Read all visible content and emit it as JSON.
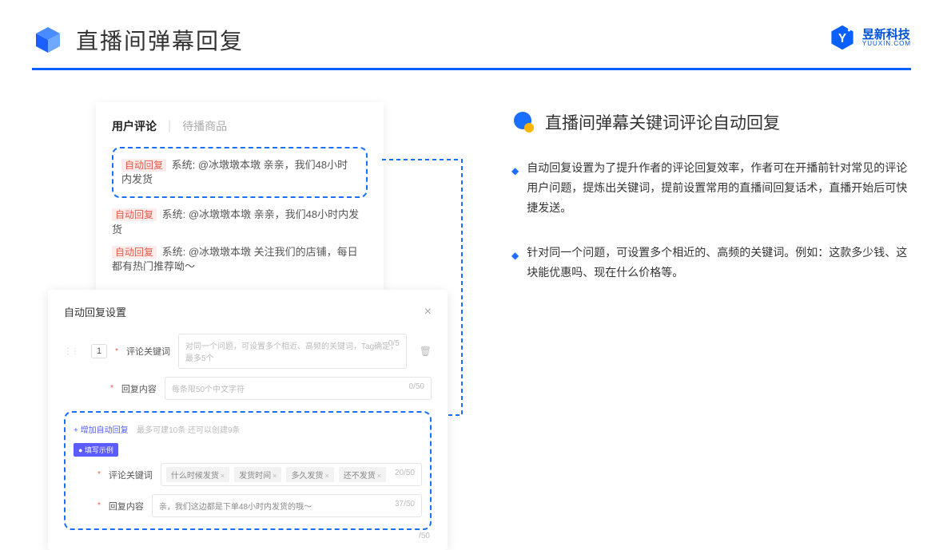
{
  "header": {
    "title": "直播间弹幕回复"
  },
  "brand": {
    "cn": "昱新科技",
    "en": "YUUXIN.COM"
  },
  "comments": {
    "tab_active": "用户评论",
    "tab_inactive": "待播商品",
    "highlight": {
      "tag": "自动回复",
      "text": "系统: @冰墩墩本墩 亲亲，我们48小时内发货"
    },
    "line2": {
      "tag": "自动回复",
      "text": "系统: @冰墩墩本墩 亲亲，我们48小时内发货"
    },
    "line3": {
      "tag": "自动回复",
      "text": "系统: @冰墩墩本墩 关注我们的店铺，每日都有热门推荐呦～"
    }
  },
  "settings": {
    "title": "自动回复设置",
    "num": "1",
    "keyword_label": "评论关键词",
    "keyword_placeholder": "对同一个问题，可设置多个相近、高频的关键词，Tag确定，最多5个",
    "keyword_counter": "0/5",
    "content_label": "回复内容",
    "content_placeholder": "每条限50个中文字符",
    "content_counter": "0/50",
    "add_link": "+ 增加自动回复",
    "add_hint": "最多可建10条 还可以创建9条",
    "example_badge": "● 填写示例",
    "ex_keyword_label": "评论关键词",
    "ex_tags": [
      "什么时候发货",
      "发货时间",
      "多久发货",
      "还不发货"
    ],
    "ex_keyword_counter": "20/50",
    "ex_content_label": "回复内容",
    "ex_content_value": "亲，我们这边都是下单48小时内发货的哦～",
    "ex_content_counter": "37/50",
    "outer_counter": "/50"
  },
  "right": {
    "section_title": "直播间弹幕关键词评论自动回复",
    "bullet1": "自动回复设置为了提升作者的评论回复效率，作者可在开播前针对常见的评论用户问题，提炼出关键词，提前设置常用的直播间回复话术，直播开始后可快捷发送。",
    "bullet2": "针对同一个问题，可设置多个相近的、高频的关键词。例如：这款多少钱、这块能优惠吗、现在什么价格等。"
  }
}
